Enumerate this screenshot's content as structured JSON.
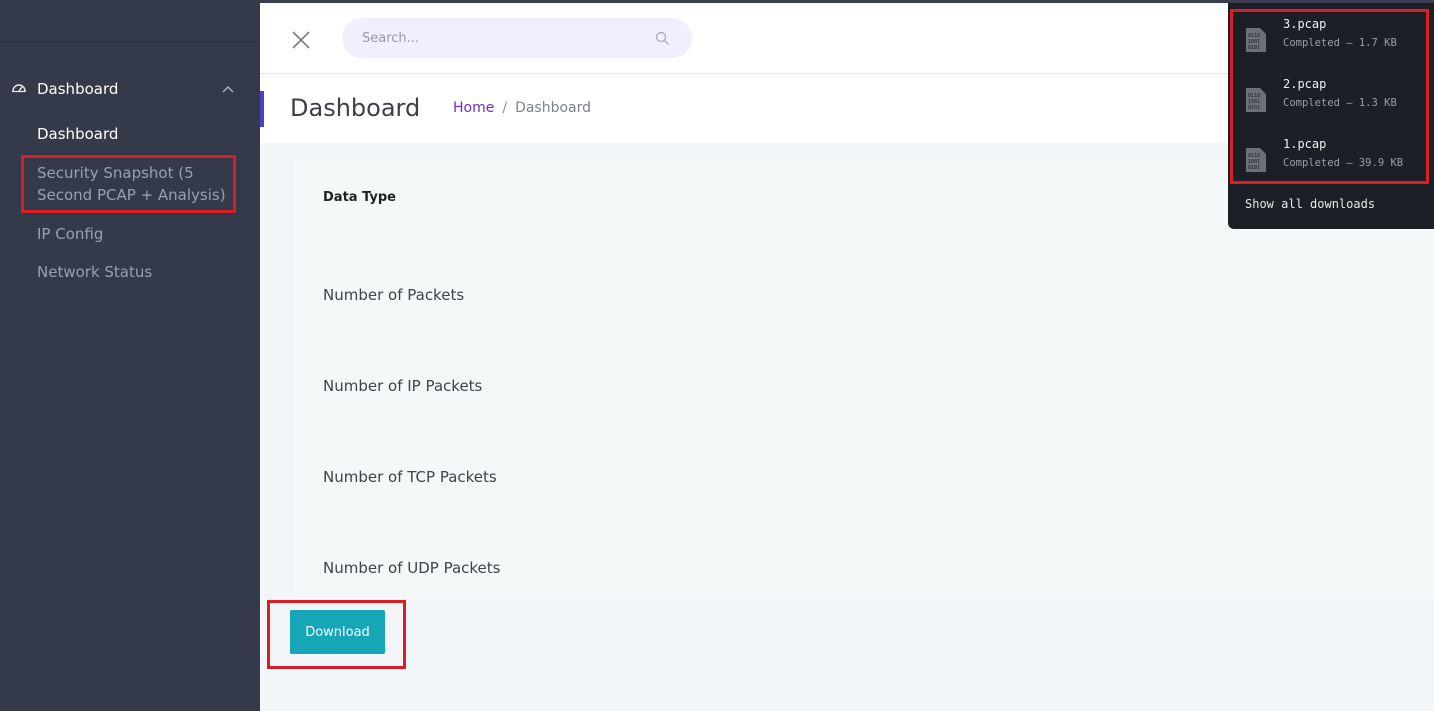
{
  "sidebar": {
    "section_title": "Dashboard",
    "items": [
      {
        "label": "Dashboard"
      },
      {
        "label": "Security Snapshot (5"
      },
      {
        "label": "Second PCAP + Analysis)"
      },
      {
        "label": "IP Config"
      },
      {
        "label": "Network Status"
      }
    ]
  },
  "header": {
    "search_placeholder": "Search..."
  },
  "page": {
    "title": "Dashboard",
    "breadcrumb": {
      "home": "Home",
      "separator": "/",
      "current": "Dashboard"
    }
  },
  "content": {
    "data_type_header": "Data Type",
    "rows": [
      "Number of Packets",
      "Number of IP Packets",
      "Number of TCP Packets",
      "Number of UDP Packets"
    ],
    "download_label": "Download"
  },
  "downloads": {
    "items": [
      {
        "name": "3.pcap",
        "status": "Completed — 1.7 KB"
      },
      {
        "name": "2.pcap",
        "status": "Completed — 1.3 KB"
      },
      {
        "name": "1.pcap",
        "status": "Completed — 39.9 KB"
      }
    ],
    "show_all_label": "Show all downloads"
  },
  "colors": {
    "sidebar_bg": "#343a4a",
    "accent_purple": "#6f2dd4",
    "download_button": "#17a5b8",
    "highlight_box": "#d81f26",
    "downloads_panel_bg": "#1d1f26"
  }
}
